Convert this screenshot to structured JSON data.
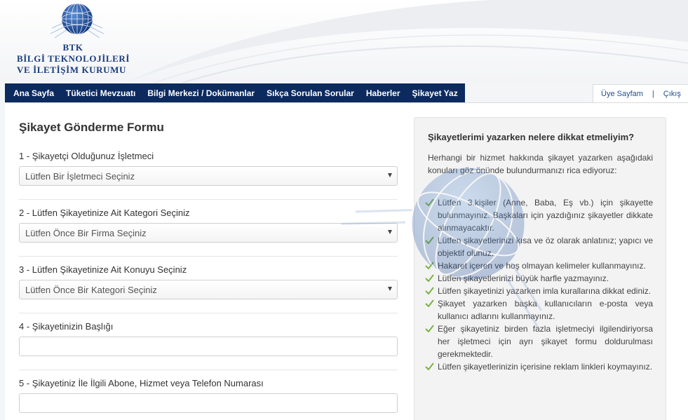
{
  "logo": {
    "acronym": "BTK",
    "line1": "BİLGİ TEKNOLOJİLERİ",
    "line2": "VE İLETİŞİM KURUMU"
  },
  "nav": {
    "items": [
      {
        "label": "Ana Sayfa"
      },
      {
        "label": "Tüketici Mevzuatı"
      },
      {
        "label": "Bilgi Merkezi / Dokümanlar"
      },
      {
        "label": "Sıkça Sorulan Sorular"
      },
      {
        "label": "Haberler"
      },
      {
        "label": "Şikayet Yaz"
      }
    ]
  },
  "user_nav": {
    "profile": "Üye Sayfam",
    "separator": "|",
    "logout": "Çıkış"
  },
  "form": {
    "title": "Şikayet Gönderme Formu",
    "fields": [
      {
        "label": "1 - Şikayetçi Olduğunuz İşletmeci",
        "value": "Lütfen Bir İşletmeci Seçiniz"
      },
      {
        "label": "2 - Lütfen Şikayetinize Ait Kategori Seçiniz",
        "value": "Lütfen Önce Bir Firma Seçiniz"
      },
      {
        "label": "3 - Lütfen Şikayetinize Ait Konuyu Seçiniz",
        "value": "Lütfen Önce Bir Kategori Seçiniz"
      },
      {
        "label": "4 - Şikayetinizin Başlığı",
        "value": ""
      },
      {
        "label": "5 - Şikayetiniz İle İlgili Abone, Hizmet veya Telefon Numarası",
        "value": ""
      }
    ]
  },
  "panel": {
    "title": "Şikayetlerimi yazarken nelere dikkat etmeliyim?",
    "intro": "Herhangi bir hizmet hakkında şikayet yazarken aşağıdaki konuları göz önünde bulundurmanızı rica ediyoruz:",
    "tips": [
      "Lütfen 3.kişiler (Anne, Baba, Eş vb.) için şikayette bulunmayınız. Başkaları için yazdığınız şikayetler dikkate alınmayacaktır.",
      "Lütfen şikayetlerinizi kısa ve öz olarak anlatınız; yapıcı ve objektif olunuz.",
      "Hakaret içeren ve hoş olmayan kelimeler kullanmayınız.",
      "Lütfen şikayetlerinizi büyük harfle yazmayınız.",
      "Lütfen şikayetinizi yazarken imla kurallarına dikkat ediniz.",
      "Şikayet yazarken başka kullanıcıların e-posta veya kullanıcı adlarını kullanmayınız.",
      "Eğer şikayetiniz birden fazla işletmeciyi ilgilendiriyorsa her işletmeci için ayrı şikayet formu doldurulması gerekmektedir.",
      "Lütfen şikayetlerinizin içerisine reklam linkleri koymayınız."
    ]
  },
  "colors": {
    "nav_bg": "#0c2a5e",
    "brand_blue": "#1a3d7c",
    "check_green": "#7cb342",
    "link_blue": "#1f4e93"
  },
  "icons": {
    "logo": "globe-icon",
    "dropdown": "caret-down-icon",
    "tip": "checkmark-icon"
  }
}
